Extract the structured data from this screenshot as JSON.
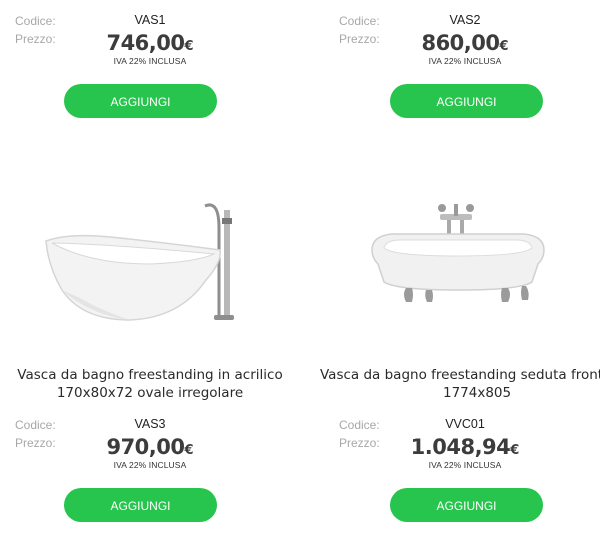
{
  "labels": {
    "code": "Codice:",
    "price": "Prezzo:"
  },
  "products": [
    {
      "code": "VAS1",
      "price": "746,00",
      "currency": "€",
      "vat": "IVA 22% INCLUSA",
      "button": "AGGIUNGI"
    },
    {
      "code": "VAS2",
      "price": "860,00",
      "currency": "€",
      "vat": "IVA 22% INCLUSA",
      "button": "AGGIUNGI"
    },
    {
      "title_line1": "Vasca da bagno freestanding in acrilico",
      "title_line2": "170x80x72 ovale irregolare",
      "code": "VAS3",
      "price": "970,00",
      "currency": "€",
      "vat": "IVA 22% INCLUSA",
      "button": "AGGIUNGI"
    },
    {
      "title_line1": "Vasca da bagno freestanding seduta frontal",
      "title_line2": "1774x805",
      "code": "VVC01",
      "price": "1.048,94",
      "currency": "€",
      "vat": "IVA 22% INCLUSA",
      "button": "AGGIUNGI"
    }
  ],
  "colors": {
    "button": "#27c44e",
    "label": "#a8a8a8",
    "price": "#3c3c3c"
  }
}
